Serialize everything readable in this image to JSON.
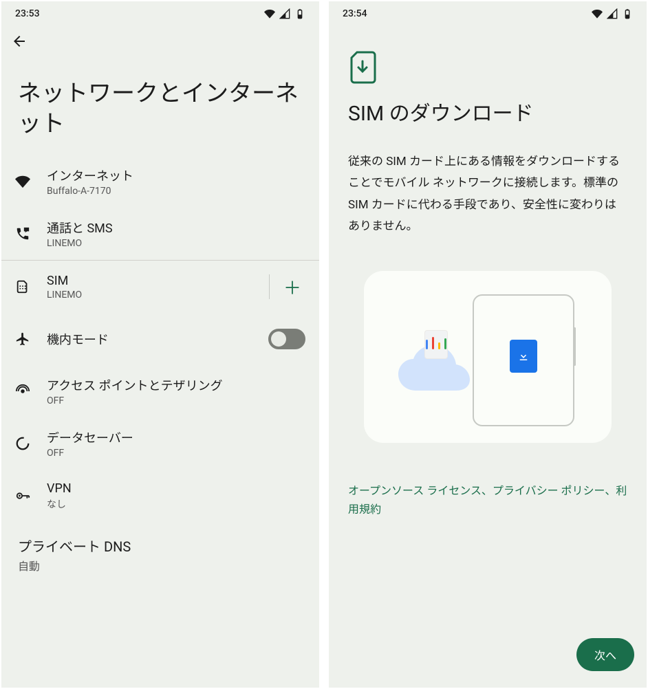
{
  "colors": {
    "accent": "#1a6e4b",
    "blue": "#1a73e8",
    "bg": "#eef1ec"
  },
  "screen1": {
    "time": "23:53",
    "title": "ネットワークとインターネット",
    "rows": {
      "internet": {
        "title": "インターネット",
        "sub": "Buffalo-A-7170"
      },
      "calls": {
        "title": "通話と SMS",
        "sub": "LINEMO"
      },
      "sim": {
        "title": "SIM",
        "sub": "LINEMO"
      },
      "airplane": {
        "title": "機内モード",
        "state": "off"
      },
      "hotspot": {
        "title": "アクセス ポイントとテザリング",
        "sub": "OFF"
      },
      "datasaver": {
        "title": "データセーバー",
        "sub": "OFF"
      },
      "vpn": {
        "title": "VPN",
        "sub": "なし"
      },
      "pdns": {
        "title": "プライベート DNS",
        "sub": "自動"
      }
    }
  },
  "screen2": {
    "time": "23:54",
    "title": "SIM のダウンロード",
    "desc": "従来の SIM カード上にある情報をダウンロードすることでモバイル ネットワークに接続します。標準の SIM カードに代わる手段であり、安全性に変わりはありません。",
    "links": "オープンソース ライセンス、プライバシー ポリシー、利用規約",
    "next": "次へ"
  }
}
